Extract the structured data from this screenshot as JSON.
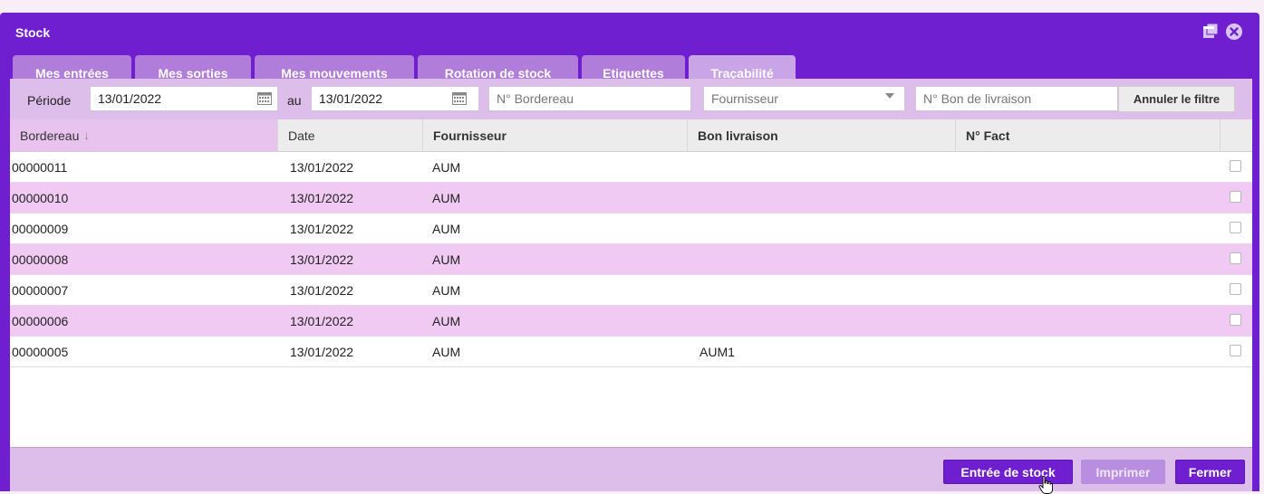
{
  "window": {
    "title": "Stock"
  },
  "tabs": [
    {
      "label": "Mes entrées"
    },
    {
      "label": "Mes sorties"
    },
    {
      "label": "Mes mouvements"
    },
    {
      "label": "Rotation de stock"
    },
    {
      "label": "Etiquettes"
    },
    {
      "label": "Traçabilité"
    }
  ],
  "filter": {
    "period_label": "Période",
    "date_from": "13/01/2022",
    "au_label": "au",
    "date_to": "13/01/2022",
    "bordereau_placeholder": "N° Bordereau",
    "fournisseur_placeholder": "Fournisseur",
    "bon_livraison_placeholder": "N° Bon de livraison",
    "clear_button": "Annuler le filtre"
  },
  "table": {
    "headers": [
      "Bordereau",
      "Date",
      "Fournisseur",
      "Bon livraison",
      "N° Fact"
    ],
    "sort_column": "Bordereau",
    "sort_icon": "arrow-down-icon",
    "rows": [
      {
        "bordereau": "00000011",
        "date": "13/01/2022",
        "fournisseur": "AUM",
        "bon_livraison": "",
        "n_fact": ""
      },
      {
        "bordereau": "00000010",
        "date": "13/01/2022",
        "fournisseur": "AUM",
        "bon_livraison": "",
        "n_fact": ""
      },
      {
        "bordereau": "00000009",
        "date": "13/01/2022",
        "fournisseur": "AUM",
        "bon_livraison": "",
        "n_fact": ""
      },
      {
        "bordereau": "00000008",
        "date": "13/01/2022",
        "fournisseur": "AUM",
        "bon_livraison": "",
        "n_fact": ""
      },
      {
        "bordereau": "00000007",
        "date": "13/01/2022",
        "fournisseur": "AUM",
        "bon_livraison": "",
        "n_fact": ""
      },
      {
        "bordereau": "00000006",
        "date": "13/01/2022",
        "fournisseur": "AUM",
        "bon_livraison": "",
        "n_fact": ""
      },
      {
        "bordereau": "00000005",
        "date": "13/01/2022",
        "fournisseur": "AUM",
        "bon_livraison": "AUM1",
        "n_fact": ""
      }
    ]
  },
  "footer": {
    "entree_button": "Entrée de stock",
    "imprimer_button": "Imprimer",
    "fermer_button": "Fermer"
  },
  "colors": {
    "accent": "#6f1fd0",
    "tab": "#b17ddb",
    "row_alt": "#f0caf3",
    "filter_bg": "#ddbde9"
  }
}
